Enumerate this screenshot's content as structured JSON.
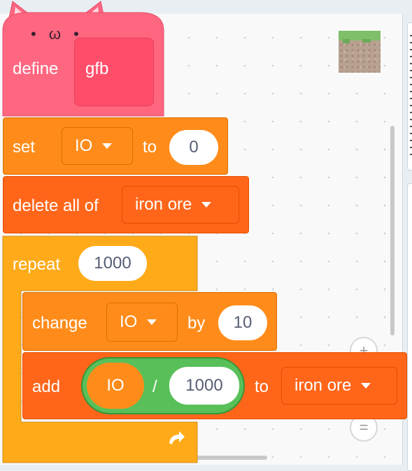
{
  "define_block": {
    "keyword": "define",
    "name": "gfb",
    "face": "• ω •"
  },
  "set_block": {
    "keyword": "set",
    "variable": "IO",
    "to_label": "to",
    "value": "0"
  },
  "delete_block": {
    "label": "delete all of",
    "list": "iron ore"
  },
  "repeat_block": {
    "keyword": "repeat",
    "times": "1000",
    "loop_icon": "loop-arrow-icon"
  },
  "change_block": {
    "keyword": "change",
    "variable": "IO",
    "by_label": "by",
    "value": "10"
  },
  "add_block": {
    "keyword": "add",
    "operator": "/",
    "left_operand": "IO",
    "right_operand": "1000",
    "to_label": "to",
    "list": "iron ore"
  },
  "zoom_controls": {
    "zoom_in": "+",
    "reset": "="
  },
  "colors": {
    "define": "#ff6680",
    "define_inner": "#ff4d6a",
    "variables": "#ff8c1a",
    "lists": "#ff661a",
    "control": "#ffab19",
    "operators": "#59c059"
  }
}
